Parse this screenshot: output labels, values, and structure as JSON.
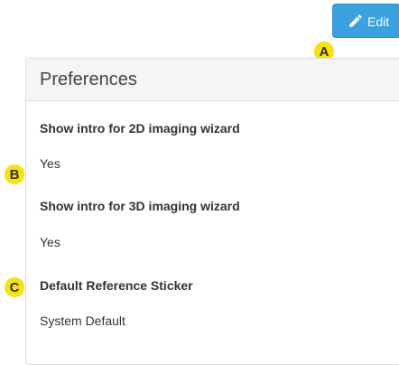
{
  "toolbar": {
    "edit_label": "Edit",
    "edit_icon": "pencil-icon",
    "accent_color": "#3aa0e0"
  },
  "markers": {
    "a": "A",
    "b": "B",
    "c": "C",
    "color": "#f5e20f"
  },
  "panel": {
    "title": "Preferences",
    "fields": [
      {
        "label": "Show intro for 2D imaging wizard",
        "value": "Yes"
      },
      {
        "label": "Show intro for 3D imaging wizard",
        "value": "Yes"
      },
      {
        "label": "Default Reference Sticker",
        "value": "System Default"
      }
    ]
  }
}
